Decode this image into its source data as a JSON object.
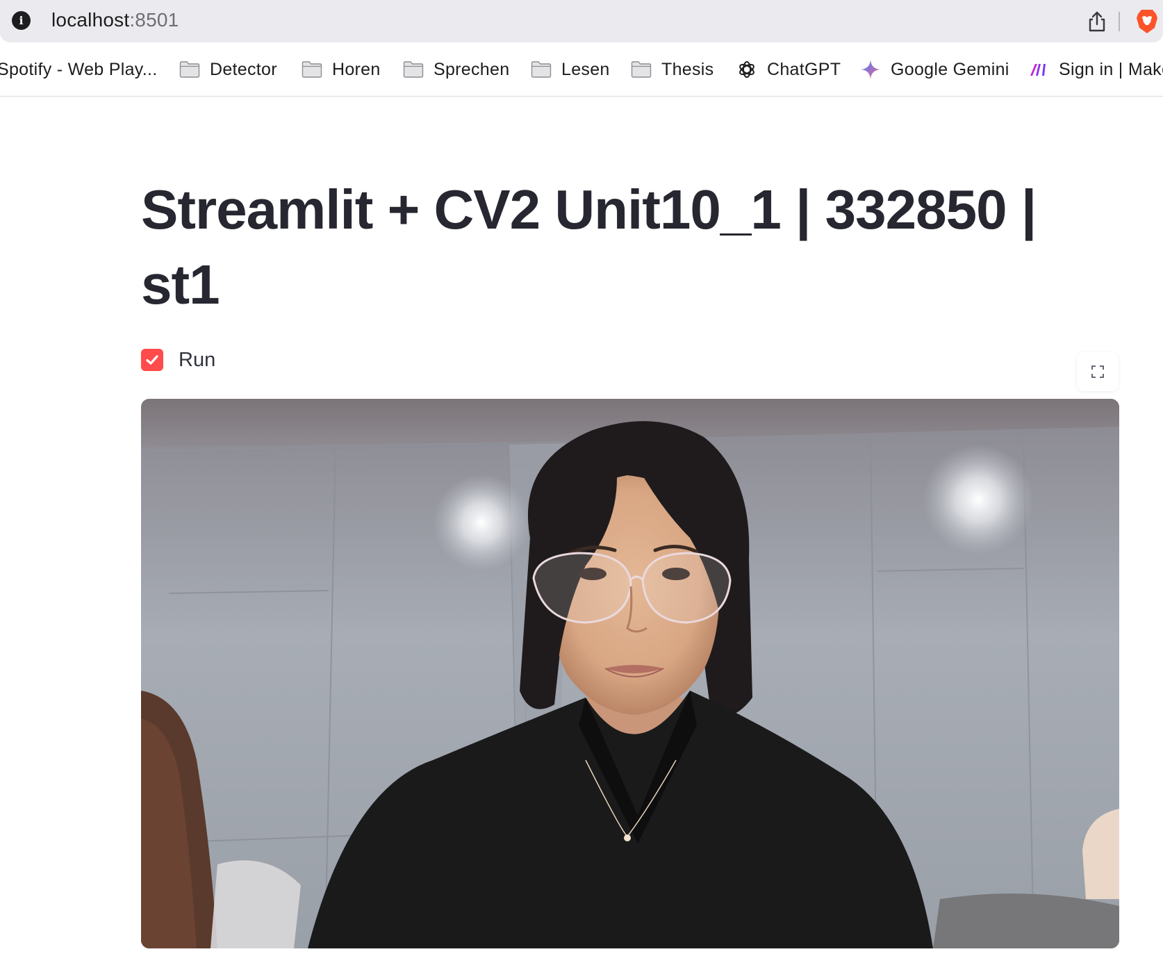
{
  "browser": {
    "url_host": "localhost",
    "url_port": ":8501",
    "info_glyph": "i",
    "icons": [
      "info-icon",
      "share-icon",
      "brave-lion-icon"
    ]
  },
  "bookmarks": [
    {
      "label": "Spotify - Web Play...",
      "icon": "none"
    },
    {
      "label": "Detector",
      "icon": "folder-icon"
    },
    {
      "label": "Horen",
      "icon": "folder-icon"
    },
    {
      "label": "Sprechen",
      "icon": "folder-icon"
    },
    {
      "label": "Lesen",
      "icon": "folder-icon"
    },
    {
      "label": "Thesis",
      "icon": "folder-icon"
    },
    {
      "label": "ChatGPT",
      "icon": "chatgpt-icon"
    },
    {
      "label": "Google Gemini",
      "icon": "gemini-icon"
    },
    {
      "label": "Sign in | Make",
      "icon": "make-icon"
    }
  ],
  "app": {
    "title": "Streamlit + CV2 Unit10_1 | 332850 | st1",
    "checkbox_label": "Run",
    "checkbox_checked": true,
    "accent_color": "#ff4b4b"
  }
}
